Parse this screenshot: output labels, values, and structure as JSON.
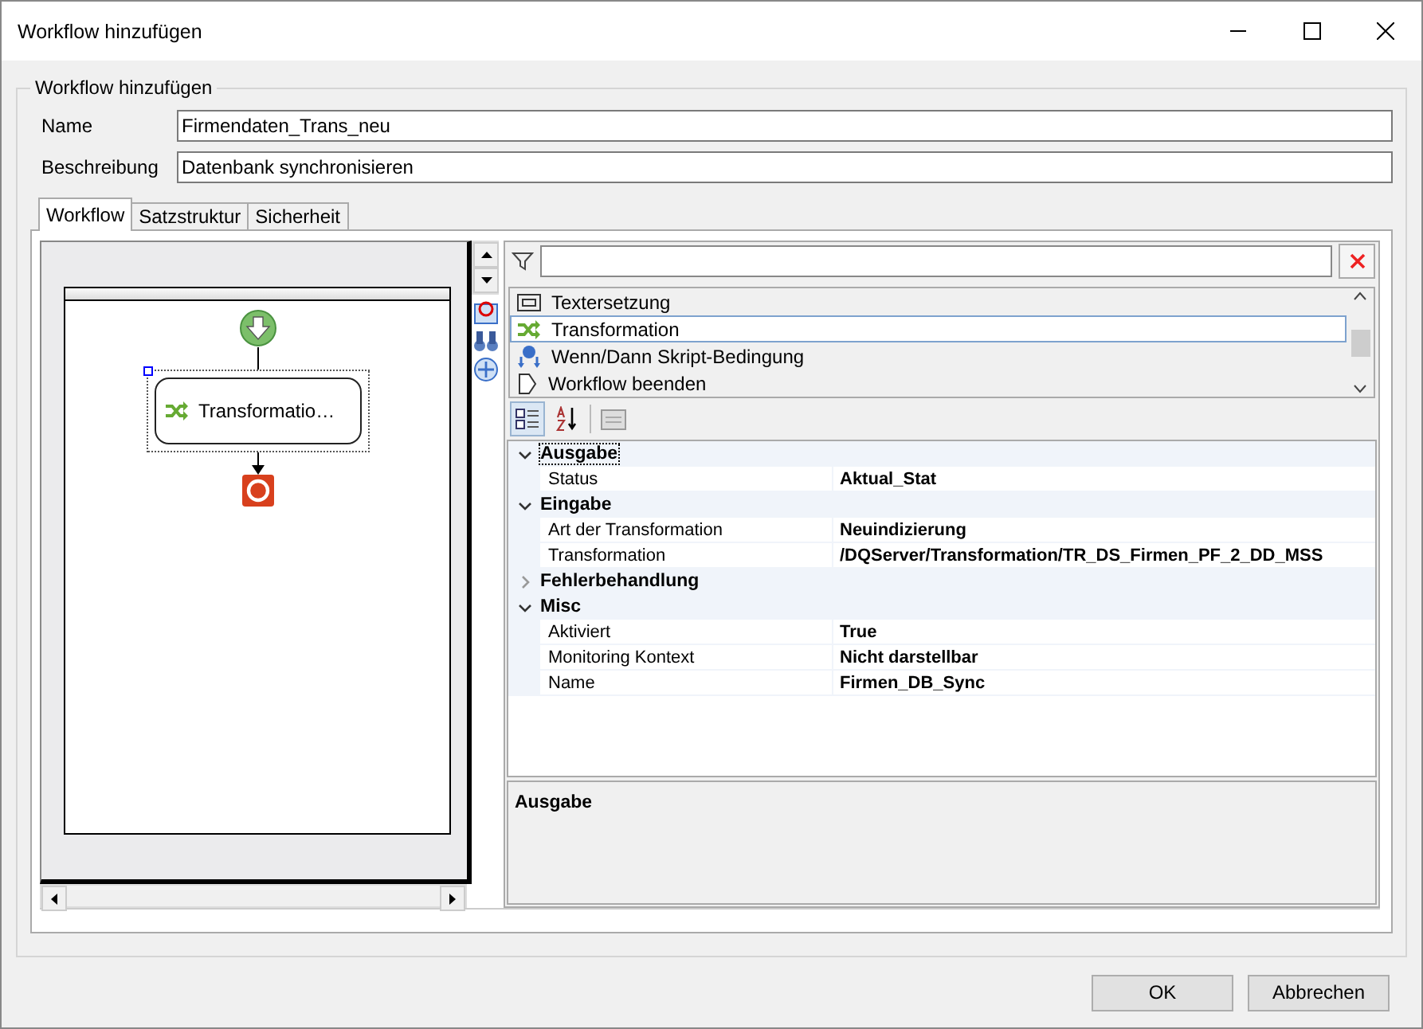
{
  "window": {
    "title": "Workflow hinzufügen"
  },
  "group": {
    "title": "Workflow hinzufügen"
  },
  "fields": [
    {
      "label": "Name",
      "value": "Firmendaten_Trans_neu"
    },
    {
      "label": "Beschreibung",
      "value": "Datenbank synchronisieren"
    }
  ],
  "tabs": [
    {
      "label": "Workflow",
      "selected": true
    },
    {
      "label": "Satzstruktur",
      "selected": false
    },
    {
      "label": "Sicherheit",
      "selected": false
    }
  ],
  "designer": {
    "nodes": [
      {
        "kind": "start"
      },
      {
        "kind": "activity",
        "label": "Transformatio…",
        "selected": true
      },
      {
        "kind": "end"
      }
    ]
  },
  "toolbox": {
    "items": [
      {
        "label": "Textersetzung",
        "selected": false
      },
      {
        "label": "Transformation",
        "selected": true
      },
      {
        "label": "Wenn/Dann Skript-Bedingung",
        "selected": false
      },
      {
        "label": "Workflow beenden",
        "selected": false
      }
    ]
  },
  "properties": {
    "categories": [
      {
        "label": "Ausgabe",
        "expanded": true,
        "selected": true,
        "rows": [
          {
            "name": "Status",
            "value": "Aktual_Stat"
          }
        ]
      },
      {
        "label": "Eingabe",
        "expanded": true,
        "selected": false,
        "rows": [
          {
            "name": "Art der Transformation",
            "value": "Neuindizierung"
          },
          {
            "name": "Transformation",
            "value": "/DQServer/Transformation/TR_DS_Firmen_PF_2_DD_MSS"
          }
        ]
      },
      {
        "label": "Fehlerbehandlung",
        "expanded": false,
        "selected": false
      },
      {
        "label": "Misc",
        "expanded": true,
        "selected": false,
        "rows": [
          {
            "name": "Aktiviert",
            "value": "True"
          },
          {
            "name": "Monitoring Kontext",
            "value": "Nicht darstellbar"
          },
          {
            "name": "Name",
            "value": "Firmen_DB_Sync"
          }
        ]
      }
    ],
    "description": {
      "title": "Ausgabe"
    }
  },
  "buttons": [
    {
      "label": "OK"
    },
    {
      "label": "Abbrechen"
    }
  ]
}
